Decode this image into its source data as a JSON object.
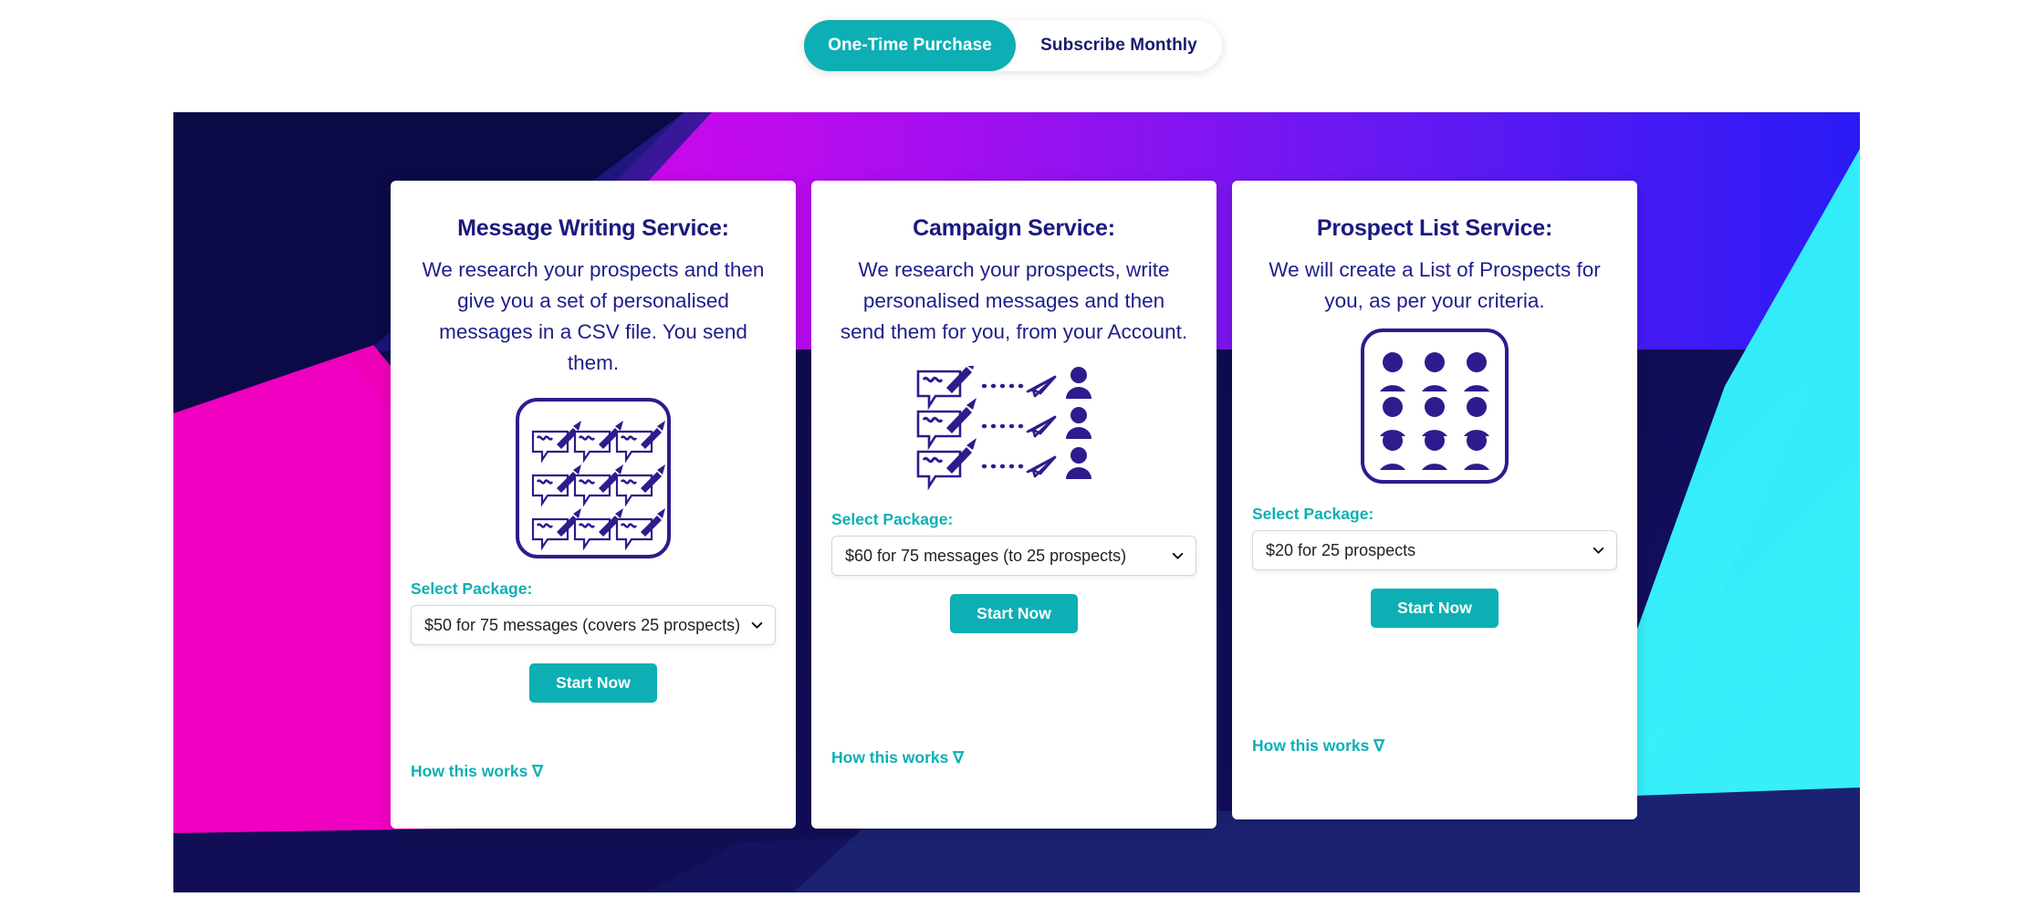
{
  "toggle": {
    "active_label": "One-Time Purchase",
    "inactive_label": "Subscribe Monthly",
    "active_color": "#0DAFB4",
    "inactive_text_color": "#1A1A6E"
  },
  "theme": {
    "teal": "#0DAFB4",
    "navy": "#1A1A7E",
    "icon_purple": "#2E1B8E",
    "banner_navy": "#0C0B4C",
    "banner_magenta": "#E800C8",
    "banner_purple": "#6B0BE8",
    "banner_blue": "#3A18F0",
    "banner_cyan": "#2CE8F5"
  },
  "cards": [
    {
      "title": "Message Writing Service:",
      "description": "We research your prospects and then give you a set of personalised messages in a CSV file. You send them.",
      "icon": "message-grid-icon",
      "select_label": "Select Package:",
      "select_value": "$50 for 75 messages (covers 25 prospects)",
      "start_label": "Start Now",
      "how_label": "How this works ∇"
    },
    {
      "title": "Campaign Service:",
      "description": "We research your prospects, write personalised messages and then send them for you, from your Account.",
      "icon": "message-send-person-icon",
      "select_label": "Select Package:",
      "select_value": "$60 for 75 messages (to 25 prospects)",
      "start_label": "Start Now",
      "how_label": "How this works ∇"
    },
    {
      "title": "Prospect List Service:",
      "description": "We will create a List of Prospects for you, as per your criteria.",
      "icon": "person-grid-icon",
      "select_label": "Select Package:",
      "select_value": "$20 for 25 prospects",
      "start_label": "Start Now",
      "how_label": "How this works ∇"
    }
  ]
}
